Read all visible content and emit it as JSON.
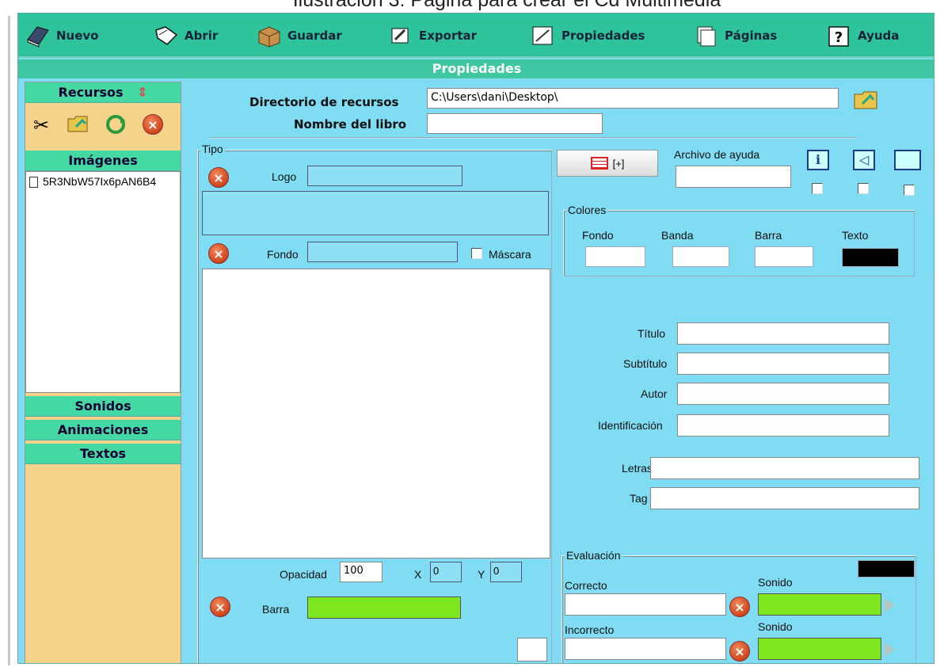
{
  "caption": "Ilustración 3: Página para crear el Cd Multimedia",
  "toolbar": {
    "items": [
      {
        "label": "Nuevo",
        "icon": "book-icon"
      },
      {
        "label": "Abrir",
        "icon": "open-icon"
      },
      {
        "label": "Guardar",
        "icon": "box-icon"
      },
      {
        "label": "Exportar",
        "icon": "export-icon"
      },
      {
        "label": "Propiedades",
        "icon": "properties-icon"
      },
      {
        "label": "Páginas",
        "icon": "pages-icon"
      },
      {
        "label": "Ayuda",
        "icon": "help-icon"
      }
    ]
  },
  "window_title": "Propiedades",
  "sidebar": {
    "recursos_label": "Recursos",
    "imagenes_label": "Imágenes",
    "file_item": "5R3NbW57Ix6pAN6B4",
    "sonidos_label": "Sonidos",
    "animaciones_label": "Animaciones",
    "textos_label": "Textos"
  },
  "form": {
    "dir_label": "Directorio de recursos",
    "dir_value": "C:\\Users\\dani\\Desktop\\",
    "book_label": "Nombre del libro",
    "book_value": "",
    "tipo_label": "Tipo",
    "logo_label": "Logo",
    "fondo_label": "Fondo",
    "mascara_label": "Máscara",
    "opacidad_label": "Opacidad",
    "opacidad_value": "100",
    "x_label": "X",
    "x_value": "0",
    "y_label": "Y",
    "y_value": "0",
    "barra_label": "Barra",
    "add_button_label": "[+]",
    "ayuda_label": "Archivo de ayuda",
    "colores_label": "Colores",
    "color_fondo": "Fondo",
    "color_banda": "Banda",
    "color_barra": "Barra",
    "color_texto": "Texto",
    "titulo_label": "Título",
    "subtitulo_label": "Subtítulo",
    "autor_label": "Autor",
    "identificacion_label": "Identificación",
    "letras_label": "Letras",
    "tag_label": "Tag",
    "evaluacion_label": "Evaluación",
    "correcto_label": "Correcto",
    "incorrecto_label": "Incorrecto",
    "sonido_label": "Sonido"
  },
  "colors": {
    "toolbar_bg": "#2ec39b",
    "app_bg": "#7fdcf2",
    "green_field": "#7ee61e",
    "sidebar_bg": "#f6d38a"
  }
}
